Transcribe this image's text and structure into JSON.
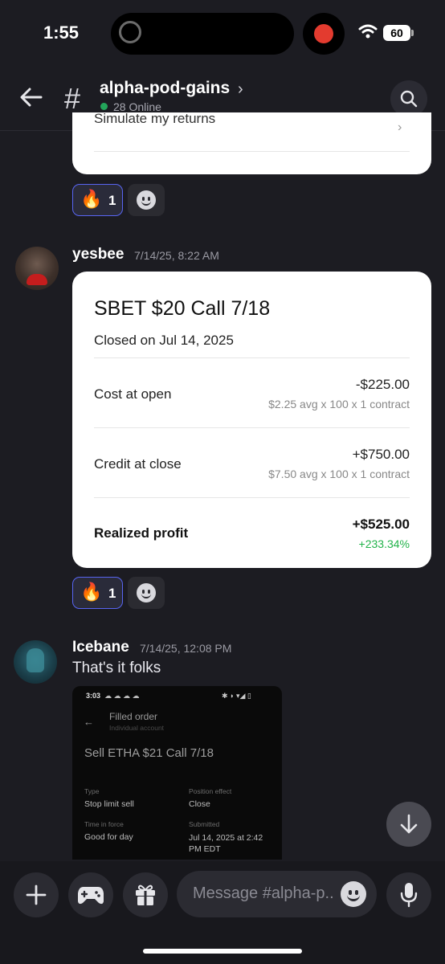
{
  "status_bar": {
    "time": "1:55",
    "battery": "60"
  },
  "header": {
    "channel_name": "alpha-pod-gains",
    "online_count": "28 Online"
  },
  "top_card": {
    "row_label": "Simulate my returns"
  },
  "reactions": [
    {
      "emoji": "🔥",
      "count": "1"
    },
    {
      "emoji": "🔥",
      "count": "1"
    }
  ],
  "messages": [
    {
      "author": "yesbee",
      "timestamp": "7/14/25, 8:22 AM",
      "card": {
        "title": "SBET $20 Call 7/18",
        "closed_on": "Closed on Jul 14, 2025",
        "rows": [
          {
            "label": "Cost at open",
            "value": "-$225.00",
            "detail": "$2.25 avg x 100 x 1 contract"
          },
          {
            "label": "Credit at close",
            "value": "+$750.00",
            "detail": "$7.50 avg x 100 x 1 contract"
          },
          {
            "label": "Realized profit",
            "value": "+$525.00",
            "detail": "+233.34%"
          }
        ]
      }
    },
    {
      "author": "Icebane",
      "timestamp": "7/14/25, 12:08 PM",
      "text": "That's it folks",
      "attachment": {
        "time": "3:03",
        "header_title": "Filled order",
        "header_subtitle": "Individual account",
        "order_title": "Sell ETHA $21 Call 7/18",
        "fields": [
          {
            "label": "Type",
            "value": "Stop limit sell"
          },
          {
            "label": "Position effect",
            "value": "Close"
          },
          {
            "label": "Time in force",
            "value": "Good for day"
          },
          {
            "label": "Submitted",
            "value": "Jul 14, 2025 at 2:42 PM EDT"
          }
        ]
      }
    }
  ],
  "composer": {
    "placeholder": "Message #alpha-p.."
  },
  "colors": {
    "background": "#1c1c22",
    "accent": "#5865f2",
    "online": "#23a55a",
    "profit": "#22b34a"
  },
  "icons": [
    "back-arrow-icon",
    "hash-icon",
    "search-icon",
    "plus-icon",
    "gamepad-icon",
    "gift-icon",
    "emoji-icon",
    "microphone-icon",
    "arrow-down-icon"
  ]
}
